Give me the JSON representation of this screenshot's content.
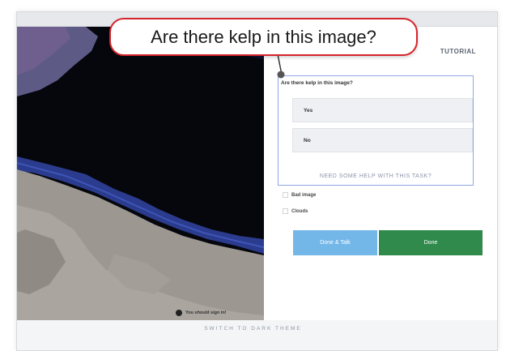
{
  "callout": {
    "text": "Are there kelp in this image?"
  },
  "header": {
    "tutorial_tab": "TUTORIAL"
  },
  "task": {
    "question": "Are there kelp in this image?",
    "answers": [
      {
        "label": "Yes"
      },
      {
        "label": "No"
      }
    ],
    "help_link": "NEED SOME HELP WITH THIS TASK?",
    "checkboxes": [
      {
        "label": "Bad image",
        "checked": false
      },
      {
        "label": "Clouds",
        "checked": false
      }
    ],
    "buttons": {
      "done_talk": "Done & Talk",
      "done": "Done"
    }
  },
  "footer": {
    "signin_note": "You should sign in!",
    "theme_switch": "SWITCH TO DARK THEME"
  },
  "colors": {
    "callout_border": "#d5252c",
    "done_talk_button": "#72b7e8",
    "done_button": "#2f8a4c",
    "question_border": "#8fa6e6"
  },
  "icons": {
    "info": "info-circle-icon"
  }
}
